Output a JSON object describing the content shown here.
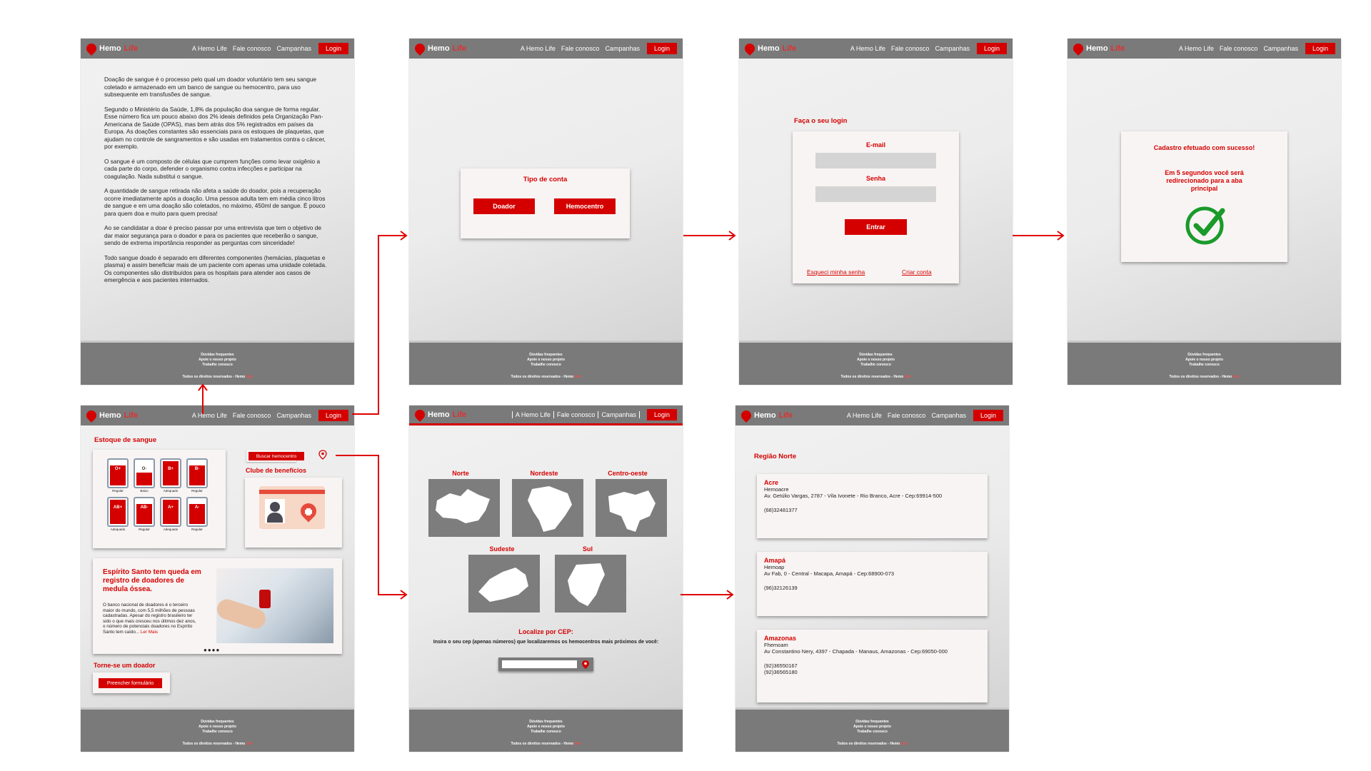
{
  "nav": {
    "brand_hemo": "Hemo",
    "brand_life": "Life",
    "links": [
      "A Hemo Life",
      "Fale conosco",
      "Campanhas"
    ],
    "login": "Login"
  },
  "footer": {
    "links": [
      "Dúvidas frequentes",
      "Apoie o nosso projeto",
      "Trabalhe conosco"
    ],
    "copy": "Todos os direitos reservados - Hemo",
    "copy_life": "Life"
  },
  "about": {
    "paragraphs": [
      "Doação de sangue é o processo pelo qual um doador voluntário tem seu sangue coletado e armazenado em um banco de sangue ou hemocentro, para uso subsequente em transfusões de sangue.",
      "Segundo o Ministério da Saúde, 1,8% da população doa sangue de forma regular. Esse número fica um pouco abaixo dos 2% ideais definidos pela Organização Pan-Americana de Saúde (OPAS), mas bem atrás dos 5% registrados em países da Europa. As doações constantes são essenciais para os estoques de plaquetas, que ajudam no controle de sangramentos e são usadas em tratamentos contra o câncer, por exemplo.",
      "O sangue é um composto de células que cumprem funções como levar oxigênio a cada parte do corpo, defender o organismo contra infecções e participar na coagulação. Nada substitui o sangue.",
      "A quantidade de sangue retirada não afeta a saúde do doador, pois a recuperação ocorre imediatamente após a doação. Uma pessoa adulta tem em média cinco litros de sangue e em uma doação são coletados, no máximo, 450ml de sangue. É pouco para quem doa e muito para quem precisa!",
      "Ao se candidatar a doar é preciso passar por uma entrevista que tem o objetivo de dar maior segurança para o doador e para os pacientes que receberão o sangue, sendo de extrema importância responder as perguntas com sinceridade!",
      "Todo sangue doado é separado em diferentes componentes (hemácias, plaquetas e plasma) e assim beneficiar mais de um paciente com apenas uma unidade coletada. Os componentes são distribuídos para os hospitais para atender aos casos de emergência e aos pacientes internados."
    ]
  },
  "account": {
    "title": "Tipo de conta",
    "donor": "Doador",
    "center": "Hemocentro"
  },
  "login": {
    "heading": "Faça o seu login",
    "email": "E-mail",
    "password": "Senha",
    "submit": "Entrar",
    "forgot": "Esqueci minha senha",
    "create": "Criar conta"
  },
  "success": {
    "title": "Cadastro efetuado com sucesso!",
    "message": "Em 5 segundos você será redirecionado para a aba principal"
  },
  "home": {
    "stock_title": "Estoque de sangue",
    "bags": [
      {
        "type": "O+",
        "status": "Regular"
      },
      {
        "type": "O-",
        "status": "Baixo"
      },
      {
        "type": "B+",
        "status": "Adequado"
      },
      {
        "type": "B-",
        "status": "Regular"
      },
      {
        "type": "AB+",
        "status": "Adequado"
      },
      {
        "type": "AB-",
        "status": "Regular"
      },
      {
        "type": "A+",
        "status": "Adequado"
      },
      {
        "type": "A-",
        "status": "Regular"
      }
    ],
    "search_btn": "Buscar hemocentro",
    "benefits": "Clube de benefícios",
    "news_title": "Espírito Santo tem queda em registro de doadores de medula óssea.",
    "news_body": "O banco nacional de doadores é o terceiro maior do mundo, com 5,5 milhões de pessoas cadastradas. Apesar do registro brasileiro ter sido o que mais cresceu nos últimos dez anos, o número de potenciais doadores no Espírito Santo tem caído...",
    "news_more": "Ler Mais",
    "become": "Torne-se um doador",
    "form_btn": "Preencher formulário"
  },
  "regions": {
    "items": [
      "Norte",
      "Nordeste",
      "Centro-oeste",
      "Sudeste",
      "Sul"
    ],
    "cep_title": "Localize por CEP:",
    "cep_hint": "Insira o seu cep (apenas números) que localizaremos os hemocentros mais próximos de você:"
  },
  "north": {
    "title": "Região Norte",
    "centers": [
      {
        "state": "Acre",
        "name": "Hemoacre",
        "address": "Av. Getúlio Vargas, 2787 - Vila Ivonete - Rio Branco, Acre - Cep:69914-500",
        "phone1": "(68)32481377",
        "phone2": ""
      },
      {
        "state": "Amapá",
        "name": "Hemoap",
        "address": "Av Fab, 0 - Central - Macapa, Amapá - Cep:68900-073",
        "phone1": "(96)32126139",
        "phone2": ""
      },
      {
        "state": "Amazonas",
        "name": "Fhemoam",
        "address": "Av Constantino Nery, 4397 - Chapada - Manaus, Amazonas - Cep:69050-000",
        "phone1": "(92)36550167",
        "phone2": "(92)36565180"
      }
    ]
  },
  "colors": {
    "accent": "#d40000",
    "nav": "#7a7a7a",
    "success": "#1a9a2a"
  }
}
